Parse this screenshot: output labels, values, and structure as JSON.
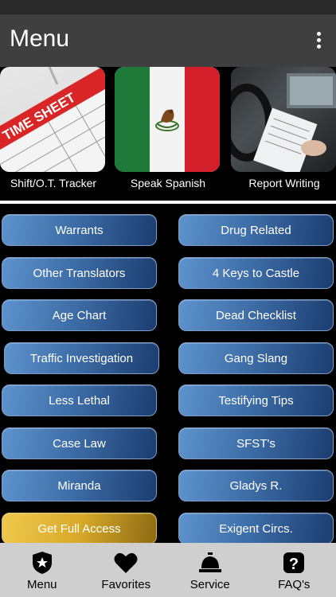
{
  "appbar": {
    "title": "Menu"
  },
  "tiles": [
    {
      "caption": "Shift/O.T. Tracker",
      "thumb_text": "TIME SHEET"
    },
    {
      "caption": "Speak Spanish"
    },
    {
      "caption": "Report Writing"
    }
  ],
  "left_buttons": [
    "Warrants",
    "Other Translators",
    "Age Chart",
    "Traffic Investigation",
    "Less Lethal",
    "Case Law",
    "Miranda",
    "Get Full Access"
  ],
  "right_buttons": [
    "Drug Related",
    "4 Keys to Castle",
    "Dead Checklist",
    "Gang Slang",
    "Testifying Tips",
    "SFST's",
    "Gladys R.",
    "Exigent Circs."
  ],
  "tabs": [
    {
      "label": "Menu",
      "icon": "badge-star-icon"
    },
    {
      "label": "Favorites",
      "icon": "heart-icon"
    },
    {
      "label": "Service",
      "icon": "service-bell-icon"
    },
    {
      "label": "FAQ's",
      "icon": "question-icon"
    }
  ],
  "colors": {
    "button_blue": "#3e6ea8",
    "button_gold": "#d8aa2a",
    "tabbar": "#cfcfcf"
  }
}
